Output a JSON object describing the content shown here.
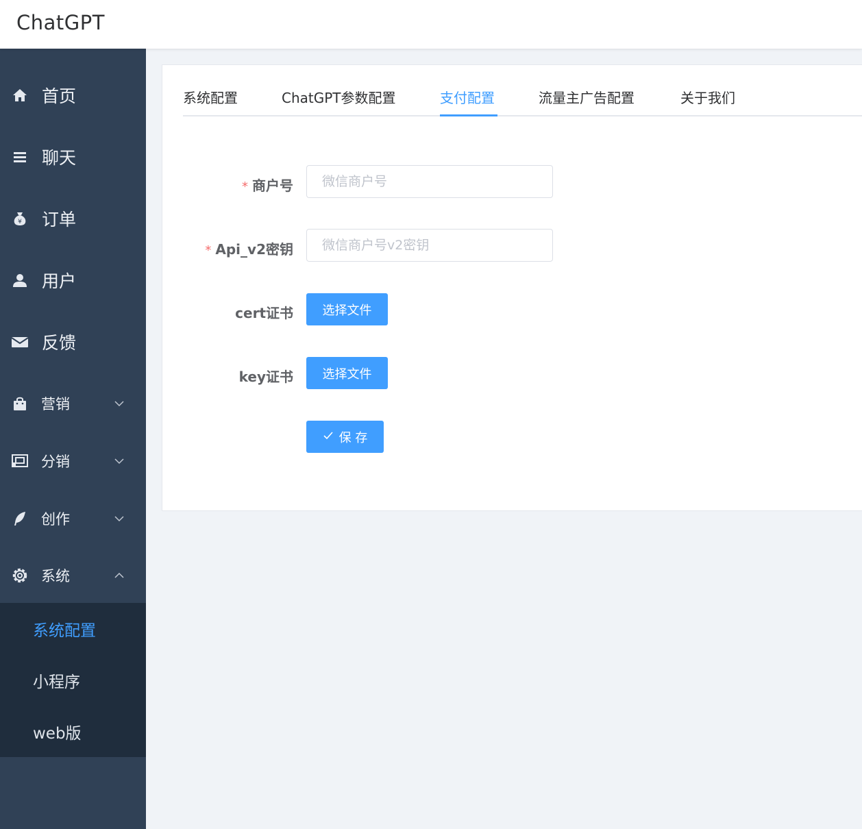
{
  "app": {
    "title": "ChatGPT"
  },
  "sidebar": {
    "items": [
      {
        "label": "首页",
        "icon": "home-icon"
      },
      {
        "label": "聊天",
        "icon": "list-icon"
      },
      {
        "label": "订单",
        "icon": "money-bag-icon"
      },
      {
        "label": "用户",
        "icon": "user-icon"
      },
      {
        "label": "反馈",
        "icon": "mail-icon"
      },
      {
        "label": "营销",
        "icon": "shopping-bag-icon",
        "expanded": false
      },
      {
        "label": "分销",
        "icon": "share-icon",
        "expanded": false
      },
      {
        "label": "创作",
        "icon": "feather-icon",
        "expanded": false
      },
      {
        "label": "系统",
        "icon": "gear-icon",
        "expanded": true
      }
    ],
    "sub_items": [
      {
        "label": "系统配置",
        "active": true
      },
      {
        "label": "小程序",
        "active": false
      },
      {
        "label": "web版",
        "active": false
      }
    ]
  },
  "tabs": [
    {
      "label": "系统配置",
      "active": false
    },
    {
      "label": "ChatGPT参数配置",
      "active": false
    },
    {
      "label": "支付配置",
      "active": true
    },
    {
      "label": "流量主广告配置",
      "active": false
    },
    {
      "label": "关于我们",
      "active": false
    }
  ],
  "form": {
    "required_mark": "*",
    "merchant_id": {
      "label": "商户号",
      "value": "",
      "placeholder": "微信商户号",
      "required": true
    },
    "api_key": {
      "label": "Api_v2密钥",
      "value": "",
      "placeholder": "微信商户号v2密钥",
      "required": true
    },
    "cert": {
      "label": "cert证书",
      "button": "选择文件"
    },
    "key": {
      "label": "key证书",
      "button": "选择文件"
    },
    "save_button": "保 存"
  },
  "colors": {
    "sidebar_bg": "#304156",
    "submenu_bg": "#1f2d3d",
    "accent": "#409eff",
    "required": "#f56c6c"
  }
}
